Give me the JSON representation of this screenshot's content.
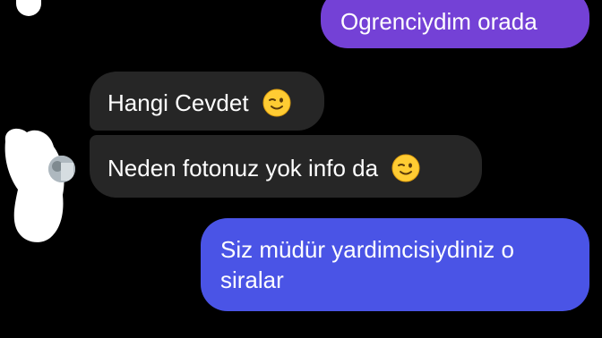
{
  "conversation": {
    "messages": [
      {
        "direction": "outgoing",
        "text": "Ogrenciydim orada",
        "emoji": null
      },
      {
        "direction": "incoming",
        "text": "Hangi Cevdet",
        "emoji": "winking-face"
      },
      {
        "direction": "incoming",
        "text": "Neden fotonuz yok info da",
        "emoji": "winking-face"
      },
      {
        "direction": "outgoing",
        "text": "Siz müdür yardimcisiydiniz o siralar",
        "emoji": null
      }
    ]
  },
  "colors": {
    "background": "#000000",
    "outgoing_purple": "#7441d6",
    "outgoing_blue": "#4a54e6",
    "incoming": "#262626",
    "text": "#ffffff"
  }
}
